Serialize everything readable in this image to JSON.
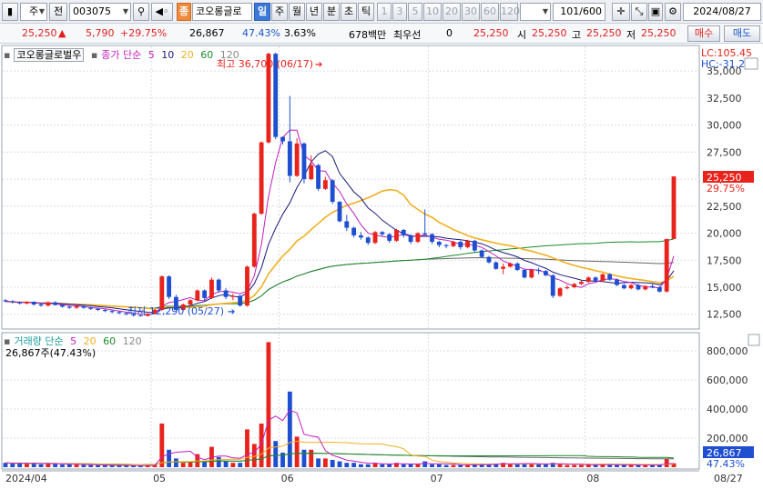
{
  "toolbar": {
    "market": "주",
    "jeon": "전",
    "code": "003075",
    "tag": "종",
    "name": "코오롱글로",
    "periods": [
      "일",
      "주",
      "월",
      "년",
      "분",
      "초",
      "틱"
    ],
    "intervals": [
      "1",
      "3",
      "5",
      "10",
      "20",
      "30",
      "60",
      "120"
    ],
    "range": "101",
    "range_total": "/600",
    "date": "2024/08/27"
  },
  "quote": {
    "price": "25,250",
    "arrow": "▲",
    "change": "5,790",
    "change_pct": "+29.75%",
    "volume": "26,867",
    "volume_ratio": "47.43%",
    "turnover": "3.63%",
    "amount": "678백만",
    "pref_label": "최우선",
    "pref_value": "0",
    "price2": "25,250",
    "open_label": "시",
    "open": "25,250",
    "high_label": "고",
    "high": "25,250",
    "low_label": "저",
    "low": "25,250",
    "buy": "매수",
    "sell": "매도"
  },
  "price_panel": {
    "name_box": "코오롱글로벌우",
    "ma_label": "종가 단순",
    "ma_periods": [
      "5",
      "10",
      "20",
      "60",
      "120"
    ],
    "lc": "LC:105.45",
    "hc": "HC:-31.20",
    "high_note": "최고 36,700 (06/17)",
    "low_note": "최저 12,290 (05/27)",
    "last_price_tag": "25,250",
    "last_pct_tag": "29.75%"
  },
  "volume_panel": {
    "label": "거래량 단순",
    "ma_periods": [
      "5",
      "20",
      "60",
      "120"
    ],
    "current": "26,867주(47.43%)",
    "last_volume_tag": "26,867",
    "last_pct_tag": "47.43%"
  },
  "x_axis": {
    "labels": [
      "2024/04",
      "05",
      "06",
      "07",
      "08"
    ],
    "last": "08/27"
  },
  "colors": {
    "up": "#e8231c",
    "down": "#1f4fd1",
    "ma5": "#c020c0",
    "ma10": "#1a1a7a",
    "ma20": "#f0b020",
    "ma60": "#1b8a2a",
    "ma120": "#666666"
  },
  "chart_data": {
    "type": "candlestick",
    "price_axis": {
      "ticks": [
        12500,
        15000,
        17500,
        20000,
        22500,
        25000,
        27500,
        30000,
        32500,
        35000
      ],
      "ylim": [
        11300,
        37200
      ]
    },
    "volume_axis": {
      "ticks": [
        200000,
        400000,
        600000,
        800000
      ],
      "ylim": [
        0,
        900000
      ]
    },
    "candles": [
      [
        13800,
        13900,
        13600,
        13700,
        30000
      ],
      [
        13700,
        13800,
        13500,
        13600,
        25000
      ],
      [
        13600,
        13700,
        13400,
        13500,
        28000
      ],
      [
        13500,
        13700,
        13400,
        13650,
        22000
      ],
      [
        13650,
        13700,
        13300,
        13400,
        30000
      ],
      [
        13400,
        13500,
        13200,
        13300,
        20000
      ],
      [
        13300,
        13700,
        13200,
        13600,
        26000
      ],
      [
        13600,
        13700,
        13300,
        13350,
        22000
      ],
      [
        13350,
        13400,
        13100,
        13200,
        18000
      ],
      [
        13200,
        13300,
        13000,
        13100,
        20000
      ],
      [
        13100,
        13300,
        13000,
        13250,
        18000
      ],
      [
        13250,
        13300,
        13000,
        13100,
        16000
      ],
      [
        13100,
        13200,
        12900,
        13000,
        15000
      ],
      [
        13000,
        13100,
        12800,
        12900,
        14000
      ],
      [
        12900,
        13000,
        12700,
        12800,
        13000
      ],
      [
        12800,
        12900,
        12600,
        12700,
        12000
      ],
      [
        12700,
        12800,
        12500,
        12600,
        12000
      ],
      [
        12600,
        12700,
        12400,
        12500,
        11000
      ],
      [
        12500,
        12600,
        12300,
        12400,
        10000
      ],
      [
        12400,
        12500,
        12290,
        12350,
        10000
      ],
      [
        12350,
        12600,
        12290,
        12550,
        12000
      ],
      [
        12550,
        13000,
        12500,
        12900,
        20000
      ],
      [
        12900,
        16100,
        12800,
        16000,
        300000
      ],
      [
        16000,
        16100,
        13900,
        14100,
        120000
      ],
      [
        14100,
        14300,
        12800,
        12900,
        60000
      ],
      [
        12900,
        13500,
        12800,
        13400,
        30000
      ],
      [
        13400,
        13900,
        13200,
        13800,
        40000
      ],
      [
        13800,
        14800,
        13700,
        14700,
        90000
      ],
      [
        14700,
        14800,
        13800,
        14000,
        40000
      ],
      [
        14000,
        15900,
        13900,
        15700,
        140000
      ],
      [
        15700,
        15800,
        14500,
        14700,
        70000
      ],
      [
        14700,
        14900,
        13900,
        14100,
        40000
      ],
      [
        14100,
        14400,
        13800,
        14200,
        30000
      ],
      [
        14200,
        14300,
        13200,
        13300,
        30000
      ],
      [
        13300,
        17000,
        13200,
        16900,
        260000
      ],
      [
        16900,
        21900,
        16800,
        21800,
        160000
      ],
      [
        21800,
        28500,
        21700,
        28400,
        300000
      ],
      [
        28400,
        36700,
        28300,
        36600,
        860000
      ],
      [
        36600,
        36700,
        28700,
        28900,
        180000
      ],
      [
        28900,
        28950,
        28200,
        28500,
        100000
      ],
      [
        28500,
        32700,
        24700,
        25300,
        520000
      ],
      [
        25300,
        28800,
        25200,
        28300,
        210000
      ],
      [
        28300,
        28400,
        24600,
        25000,
        120000
      ],
      [
        25000,
        27200,
        24900,
        26300,
        120000
      ],
      [
        26300,
        26400,
        23900,
        24100,
        60000
      ],
      [
        24100,
        25200,
        24000,
        24900,
        60000
      ],
      [
        24900,
        25000,
        22700,
        22900,
        50000
      ],
      [
        22900,
        23000,
        21000,
        21100,
        40000
      ],
      [
        21100,
        21700,
        20200,
        20500,
        30000
      ],
      [
        20500,
        20600,
        19600,
        19800,
        30000
      ],
      [
        19800,
        20100,
        19400,
        19600,
        20000
      ],
      [
        19600,
        19700,
        18900,
        19100,
        20000
      ],
      [
        19100,
        20200,
        19000,
        20100,
        30000
      ],
      [
        20100,
        20200,
        19700,
        19900,
        20000
      ],
      [
        19900,
        20000,
        19100,
        19300,
        20000
      ],
      [
        19300,
        20400,
        19200,
        20300,
        30000
      ],
      [
        20300,
        20400,
        19600,
        19800,
        20000
      ],
      [
        19800,
        19900,
        19000,
        19200,
        20000
      ],
      [
        19200,
        20100,
        19100,
        20000,
        20000
      ],
      [
        20000,
        22200,
        19800,
        19900,
        40000
      ],
      [
        19900,
        20000,
        19000,
        19200,
        20000
      ],
      [
        19200,
        19300,
        18700,
        18900,
        20000
      ],
      [
        18900,
        19000,
        18600,
        18800,
        15000
      ],
      [
        18800,
        19300,
        18700,
        19200,
        15000
      ],
      [
        19200,
        19300,
        18500,
        18700,
        15000
      ],
      [
        18700,
        19400,
        18600,
        19300,
        15000
      ],
      [
        19300,
        19400,
        18200,
        18400,
        20000
      ],
      [
        18400,
        18500,
        17700,
        17800,
        20000
      ],
      [
        17800,
        17900,
        17200,
        17300,
        20000
      ],
      [
        17300,
        17400,
        16600,
        16700,
        25000
      ],
      [
        16700,
        17200,
        16200,
        16900,
        30000
      ],
      [
        16900,
        17300,
        16800,
        17200,
        25000
      ],
      [
        17200,
        17300,
        16500,
        16600,
        20000
      ],
      [
        16600,
        16700,
        15800,
        15900,
        25000
      ],
      [
        15900,
        16700,
        15800,
        16600,
        25000
      ],
      [
        16600,
        16800,
        16200,
        16500,
        20000
      ],
      [
        16500,
        16600,
        16000,
        16100,
        20000
      ],
      [
        16100,
        16200,
        14000,
        14200,
        30000
      ],
      [
        14200,
        15000,
        14100,
        14900,
        25000
      ],
      [
        14900,
        15200,
        14800,
        15000,
        15000
      ],
      [
        15000,
        15400,
        14900,
        15300,
        15000
      ],
      [
        15300,
        15600,
        15200,
        15500,
        15000
      ],
      [
        15500,
        16000,
        15400,
        15900,
        20000
      ],
      [
        15900,
        16000,
        15500,
        15600,
        15000
      ],
      [
        15600,
        16300,
        15500,
        16200,
        20000
      ],
      [
        16200,
        16300,
        15600,
        15700,
        15000
      ],
      [
        15700,
        15800,
        15100,
        15200,
        15000
      ],
      [
        15200,
        15300,
        14800,
        14900,
        15000
      ],
      [
        14900,
        15300,
        14800,
        15200,
        15000
      ],
      [
        15200,
        15300,
        14700,
        14800,
        15000
      ],
      [
        14800,
        15200,
        14700,
        15100,
        15000
      ],
      [
        15100,
        15300,
        14900,
        15000,
        15000
      ],
      [
        15000,
        15100,
        14500,
        14600,
        15000
      ],
      [
        14600,
        19500,
        14500,
        19460,
        56000
      ],
      [
        19460,
        25250,
        19460,
        25250,
        26867
      ]
    ]
  }
}
